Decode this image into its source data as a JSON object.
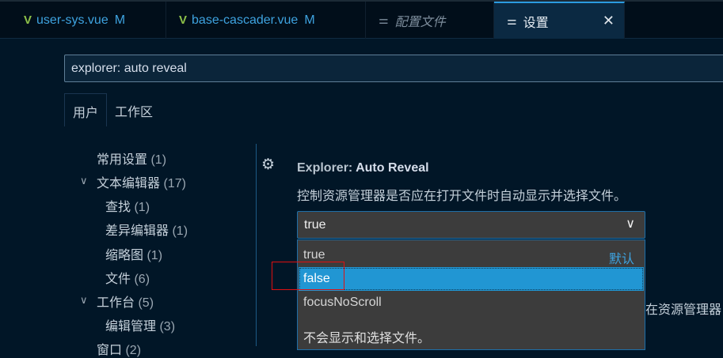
{
  "tabs": [
    {
      "label": "user-sys.vue",
      "badge": "M"
    },
    {
      "label": "base-cascader.vue",
      "badge": "M"
    },
    {
      "label": "配置文件"
    },
    {
      "label": "设置",
      "close": "✕"
    }
  ],
  "search": {
    "value": "explorer: auto reveal"
  },
  "scope_tabs": [
    "用户",
    "工作区"
  ],
  "tree": [
    {
      "label": "常用设置",
      "count": "(1)"
    },
    {
      "label": "文本编辑器",
      "count": "(17)"
    },
    {
      "label": "查找",
      "count": "(1)"
    },
    {
      "label": "差异编辑器",
      "count": "(1)"
    },
    {
      "label": "缩略图",
      "count": "(1)"
    },
    {
      "label": "文件",
      "count": "(6)"
    },
    {
      "label": "工作台",
      "count": "(5)"
    },
    {
      "label": "编辑管理",
      "count": "(3)"
    },
    {
      "label": "窗口",
      "count": "(2)"
    }
  ],
  "setting": {
    "prefix": "Explorer: ",
    "title": "Auto Reveal",
    "description": "控制资源管理器是否应在打开文件时自动显示并选择文件。",
    "value": "true",
    "options": [
      {
        "label": "true",
        "tag": "默认"
      },
      {
        "label": "false"
      },
      {
        "label": "focusNoScroll"
      }
    ],
    "option_description": "不会显示和选择文件。",
    "behind_text": "在资源管理器"
  }
}
